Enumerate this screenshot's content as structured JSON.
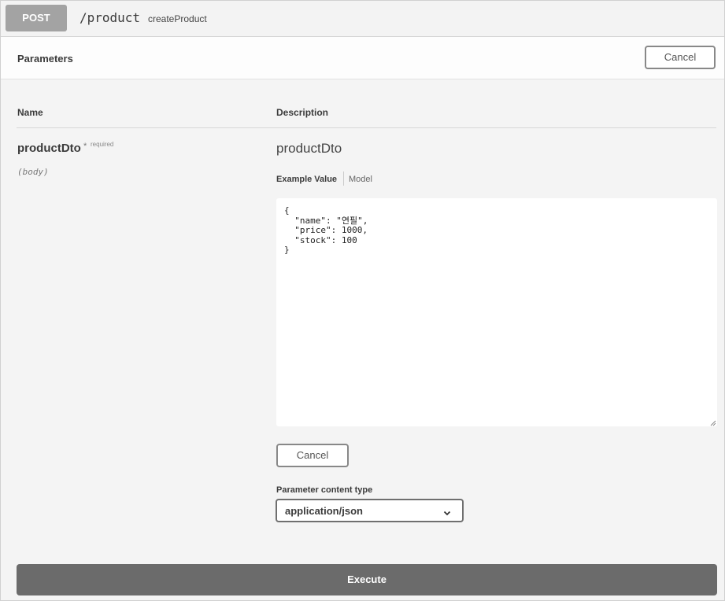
{
  "summary": {
    "method": "POST",
    "path": "/product",
    "operation_id": "createProduct"
  },
  "parameters": {
    "title": "Parameters",
    "cancel_label": "Cancel",
    "col_name": "Name",
    "col_description": "Description",
    "items": [
      {
        "name": "productDto",
        "required_mark": "*",
        "required_label": "required",
        "in": "(body)",
        "description": "productDto",
        "tabs": {
          "example_value": "Example Value",
          "model": "Model"
        },
        "body_value": "{\n  \"name\": \"연필\",\n  \"price\": 1000,\n  \"stock\": 100\n}",
        "cancel_label": "Cancel",
        "content_type_label": "Parameter content type",
        "content_type_selected": "application/json"
      }
    ]
  },
  "execute_label": "Execute",
  "colors": {
    "method_bg": "#a3a3a3",
    "execute_bg": "#6b6b6b",
    "header_bg": "#fdfdfd",
    "body_bg": "#f4f4f4"
  },
  "icons": {
    "select_arrow": "chevron-down-icon",
    "resize": "resize-grip-icon"
  }
}
